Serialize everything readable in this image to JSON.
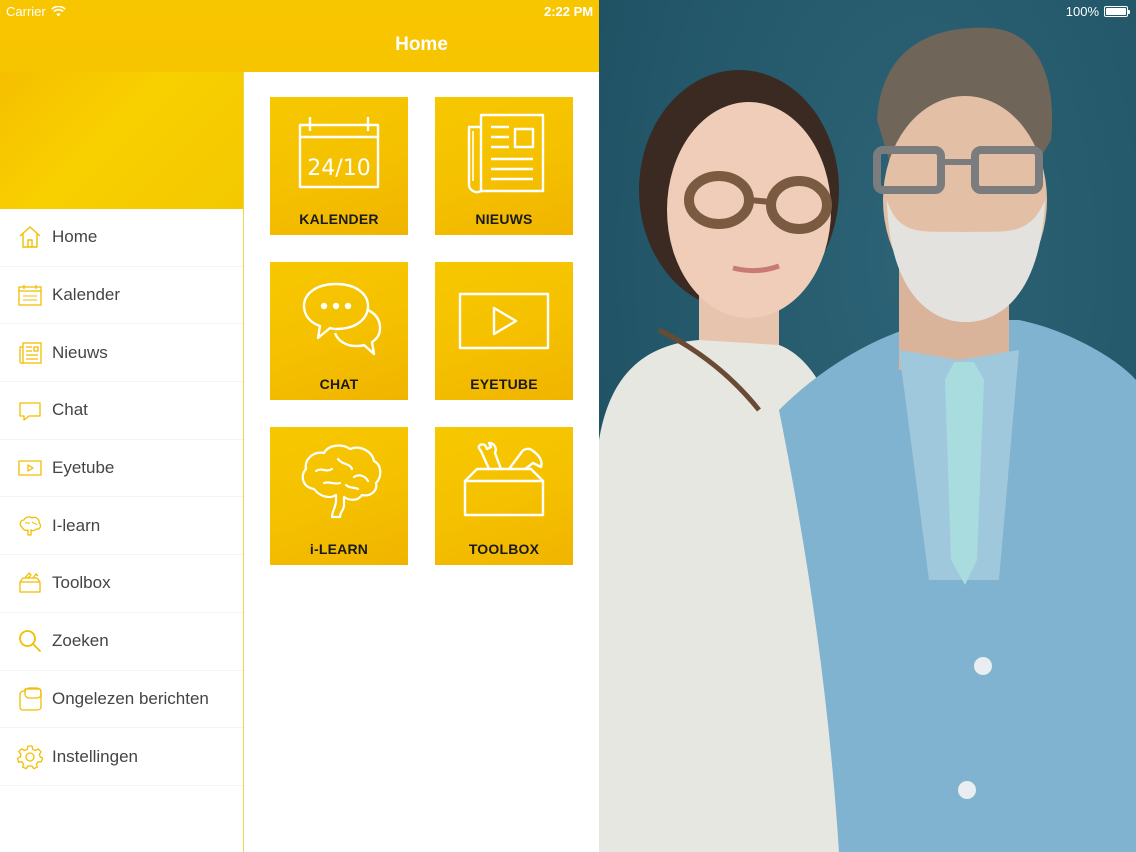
{
  "status_bar": {
    "carrier": "Carrier",
    "time": "2:22 PM",
    "battery": "100%"
  },
  "navbar": {
    "title": "Home"
  },
  "sidebar": {
    "items": [
      {
        "label": "Home",
        "icon": "home-icon"
      },
      {
        "label": "Kalender",
        "icon": "calendar-icon"
      },
      {
        "label": "Nieuws",
        "icon": "newspaper-icon"
      },
      {
        "label": "Chat",
        "icon": "chat-icon"
      },
      {
        "label": "Eyetube",
        "icon": "video-play-icon"
      },
      {
        "label": "I-learn",
        "icon": "brain-icon"
      },
      {
        "label": "Toolbox",
        "icon": "toolbox-icon"
      },
      {
        "label": "Zoeken",
        "icon": "search-icon"
      },
      {
        "label": "Ongelezen berichten",
        "icon": "unread-messages-icon"
      },
      {
        "label": "Instellingen",
        "icon": "gear-icon"
      }
    ]
  },
  "tiles": [
    {
      "label": "KALENDER",
      "icon": "calendar-icon",
      "calendar_date": "24/10"
    },
    {
      "label": "NIEUWS",
      "icon": "newspaper-icon"
    },
    {
      "label": "CHAT",
      "icon": "chat-icon"
    },
    {
      "label": "EYETUBE",
      "icon": "video-play-icon"
    },
    {
      "label": "i-LEARN",
      "icon": "brain-icon"
    },
    {
      "label": "TOOLBOX",
      "icon": "toolbox-icon"
    }
  ],
  "colors": {
    "accent": "#f7c400",
    "tile_label": "#1a1a1a",
    "menu_text": "#444444",
    "photo_background": "#24596b"
  }
}
